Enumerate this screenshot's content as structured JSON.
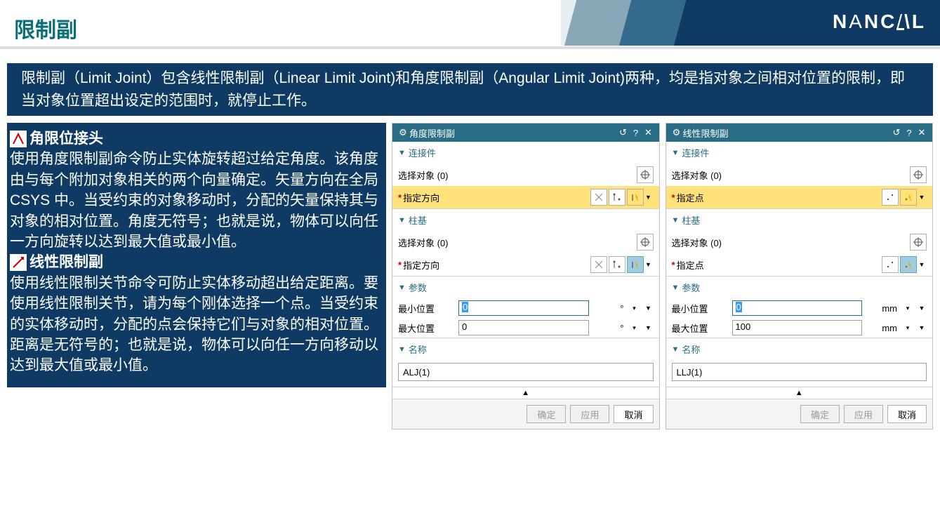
{
  "header": {
    "title": "限制副",
    "logo": "NANCAL"
  },
  "intro": "限制副（Limit Joint）包含线性限制副（Linear Limit Joint)和角度限制副（Angular Limit Joint)两种，均是指对象之间相对位置的限制，即当对象位置超出设定的范围时，就停止工作。",
  "left": {
    "h1": "角限位接头",
    "p1": "使用角度限制副命令防止实体旋转超过给定角度。该角度由与每个附加对象相关的两个向量确定。矢量方向在全局 CSYS 中。当受约束的对象移动时，分配的矢量保持其与对象的相对位置。角度无符号；也就是说，物体可以向任一方向旋转以达到最大值或最小值。",
    "h2": "线性限制副",
    "p2": "使用线性限制关节命令可防止实体移动超出给定距离。要使用线性限制关节，请为每个刚体选择一个点。当受约束的实体移动时，分配的点会保持它们与对象的相对位置。距离是无符号的；也就是说，物体可以向任一方向移动以达到最大值或最小值。"
  },
  "labels": {
    "connector": "连接件",
    "select_obj": "选择对象 (0)",
    "spec_dir": "指定方向",
    "spec_point": "指定点",
    "base": "柱基",
    "params": "参数",
    "min_pos": "最小位置",
    "max_pos": "最大位置",
    "name": "名称",
    "ok": "确定",
    "apply": "应用",
    "cancel": "取消"
  },
  "dlg1": {
    "title": "角度限制副",
    "min_val": "0",
    "min_unit": "°",
    "max_val": "0",
    "max_unit": "°",
    "name_val": "ALJ(1)"
  },
  "dlg2": {
    "title": "线性限制副",
    "min_val": "0",
    "min_unit": "mm",
    "max_val": "100",
    "max_unit": "mm",
    "name_val": "LLJ(1)"
  }
}
